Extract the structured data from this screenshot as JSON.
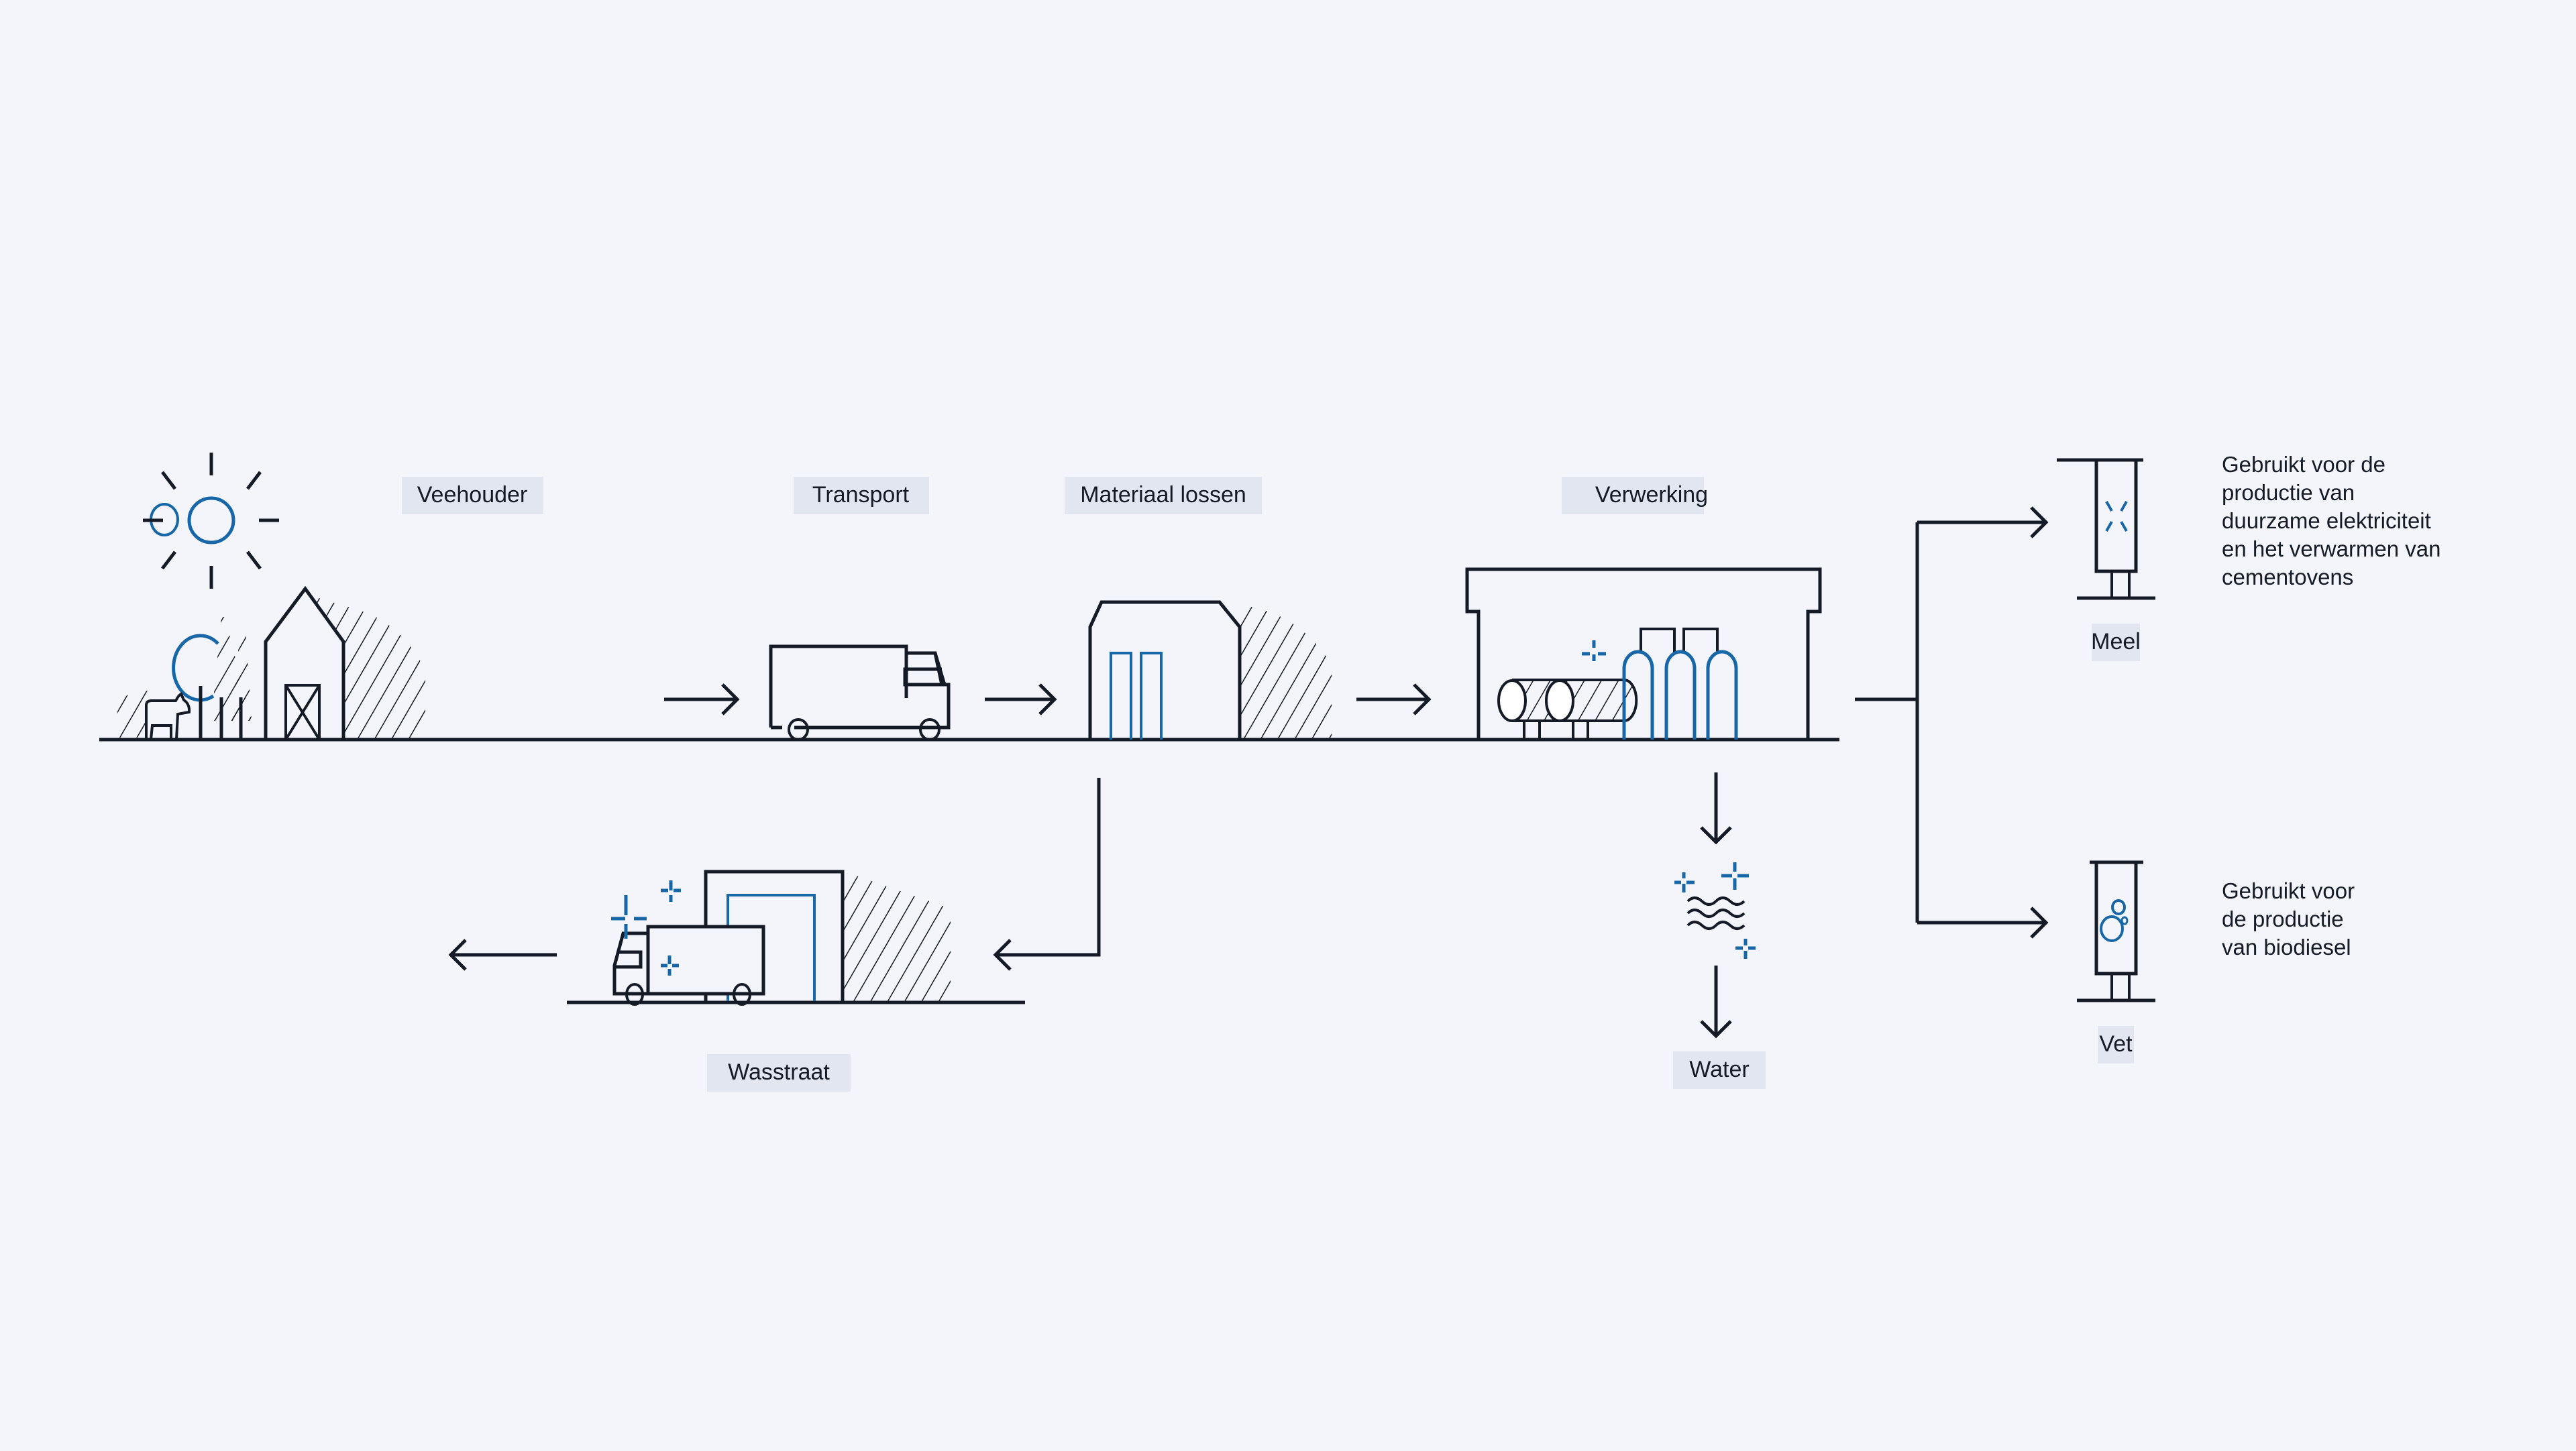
{
  "diagram": {
    "language": "nl",
    "colors": {
      "background": "#f3f5fa",
      "line": "#141a26",
      "accent": "#1766a8",
      "label_bg": "#e1e6f1"
    },
    "stages": [
      {
        "id": "veehouder",
        "label": "Veehouder",
        "icon": "farm-barn-icon"
      },
      {
        "id": "transport",
        "label": "Transport",
        "icon": "truck-icon"
      },
      {
        "id": "materiaal-lossen",
        "label": "Materiaal lossen",
        "icon": "warehouse-icon"
      },
      {
        "id": "verwerking",
        "label": "Verwerking",
        "icon": "processing-plant-icon"
      },
      {
        "id": "wasstraat",
        "label": "Wasstraat",
        "icon": "truck-wash-icon"
      },
      {
        "id": "water",
        "label": "Water",
        "icon": "water-waves-icon"
      }
    ],
    "outputs": [
      {
        "id": "meel",
        "label": "Meel",
        "icon": "silo-icon",
        "description_lines": [
          "Gebruikt voor de",
          "productie van",
          "duurzame elektriciteit",
          "en het verwarmen van",
          "cementovens"
        ]
      },
      {
        "id": "vet",
        "label": "Vet",
        "icon": "silo-bubbles-icon",
        "description_lines": [
          "Gebruikt voor",
          "de productie",
          "van biodiesel"
        ]
      }
    ],
    "edges": [
      {
        "from": "veehouder",
        "to": "transport"
      },
      {
        "from": "transport",
        "to": "materiaal-lossen"
      },
      {
        "from": "materiaal-lossen",
        "to": "verwerking"
      },
      {
        "from": "materiaal-lossen",
        "to": "wasstraat"
      },
      {
        "from": "wasstraat",
        "to": "exit"
      },
      {
        "from": "verwerking",
        "to": "water"
      },
      {
        "from": "verwerking",
        "to": "meel"
      },
      {
        "from": "verwerking",
        "to": "vet"
      }
    ]
  }
}
